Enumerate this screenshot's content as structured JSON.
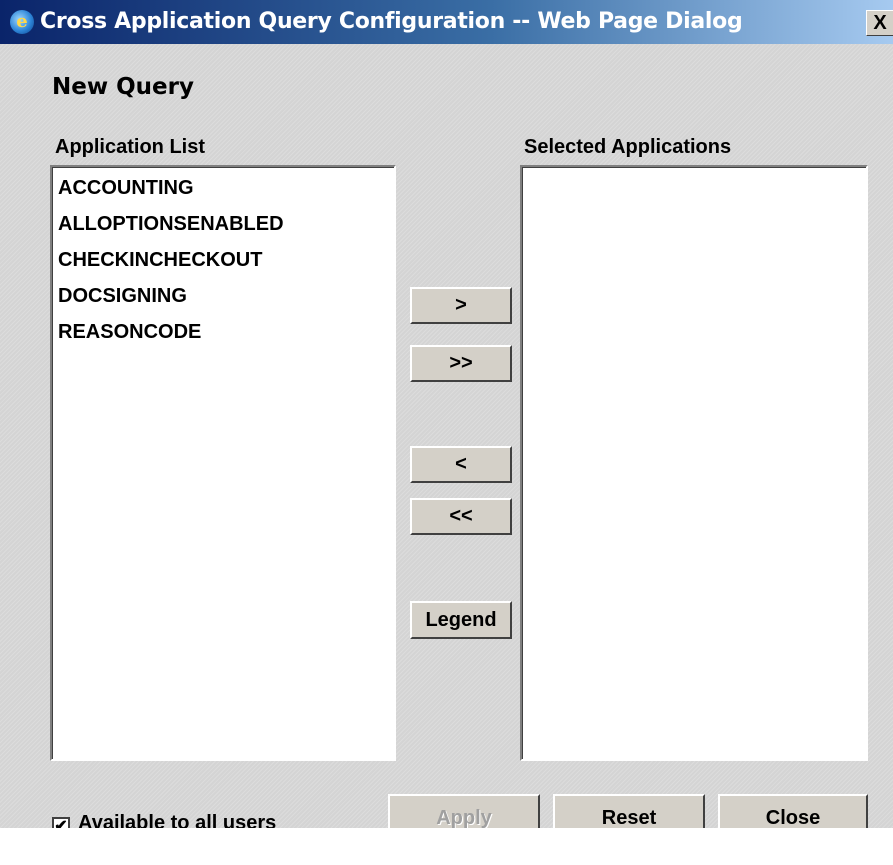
{
  "window": {
    "title": "Cross Application Query Configuration -- Web Page Dialog",
    "close_glyph": "X",
    "app_icon": "ie-icon"
  },
  "heading": "New Query",
  "application_list": {
    "label": "Application List",
    "items": [
      "ACCOUNTING",
      "ALLOPTIONSENABLED",
      "CHECKINCHECKOUT",
      "DOCSIGNING",
      "REASONCODE"
    ]
  },
  "selected_applications": {
    "label": "Selected Applications",
    "items": []
  },
  "transfer_buttons": {
    "add": ">",
    "add_all": ">>",
    "remove": "<",
    "remove_all": "<<",
    "legend": "Legend"
  },
  "footer": {
    "available_checkbox_label": "Available to all users",
    "available_checked": true,
    "check_glyph": "✔",
    "apply": "Apply",
    "reset": "Reset",
    "close": "Close"
  }
}
